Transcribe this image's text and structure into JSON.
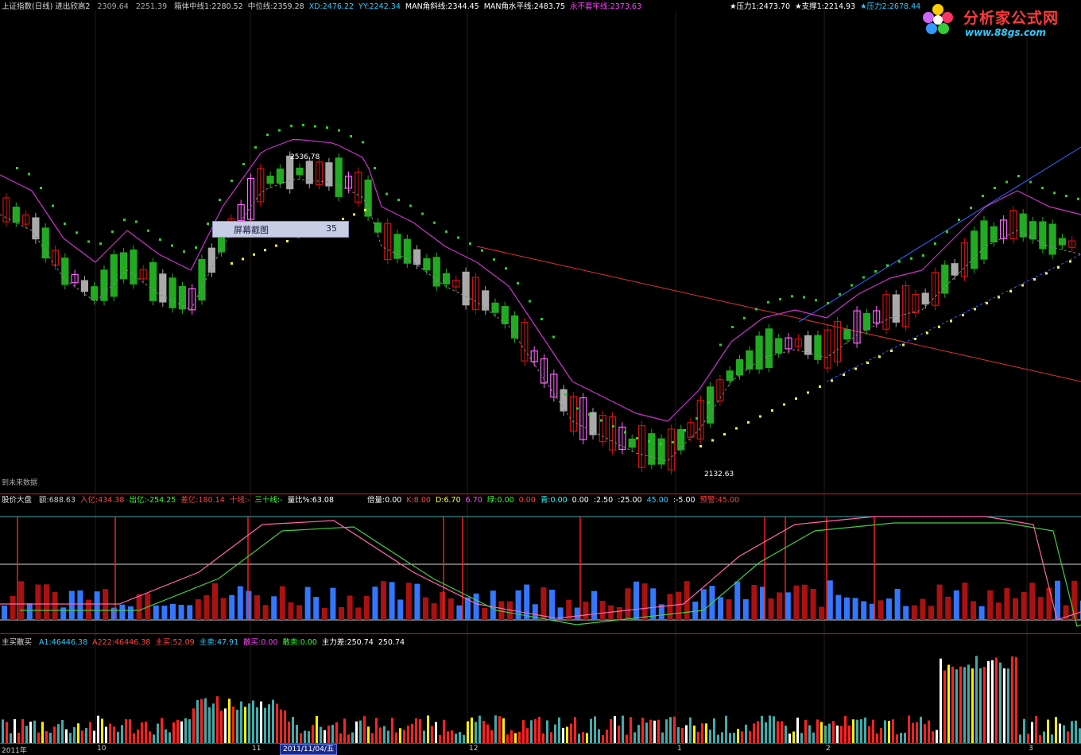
{
  "header": {
    "title": "上证指数(日线) 进出欣高2",
    "v1": "2309.64",
    "v2": "2251.39",
    "items": [
      {
        "label": "箱体中线1:",
        "value": "2280.52",
        "color": "#cccccc"
      },
      {
        "label": "中位线:",
        "value": "2359.28",
        "color": "#cccccc"
      },
      {
        "label": "XD:",
        "value": "2476.22",
        "color": "#33ccff"
      },
      {
        "label": "YY:",
        "value": "2242.34",
        "color": "#33ccff"
      },
      {
        "label": "MAN角斜线:",
        "value": "2344.45",
        "color": "#ffffff"
      },
      {
        "label": "MAN角水平线:",
        "value": "2483.75",
        "color": "#ffffff"
      },
      {
        "label": "永不套牢线:",
        "value": "2373.63",
        "color": "#ff44ff"
      }
    ],
    "right": [
      {
        "label": "★压力1:",
        "value": "2473.70",
        "color": "#ffffff"
      },
      {
        "label": "★支撑1:",
        "value": "2214.93",
        "color": "#ffffff"
      },
      {
        "label": "★压力2:",
        "value": "2678.44",
        "color": "#33ccff"
      }
    ]
  },
  "logo": {
    "title": "分析家公式网",
    "url": "www.88gs.com"
  },
  "tooltip": {
    "label": "屏幕截图",
    "value": "35"
  },
  "price_labels": {
    "high": "2536.78",
    "low": "2132.63"
  },
  "future_note": "到未来数据",
  "panel2": {
    "name": "股价大盘",
    "items": [
      {
        "label": "额:",
        "value": "688.63",
        "color": "#cccccc"
      },
      {
        "label": "入亿:",
        "value": "434.38",
        "color": "#ff4444"
      },
      {
        "label": "出亿:",
        "value": "-254.25",
        "color": "#33ff33"
      },
      {
        "label": "差亿:",
        "value": "180.14",
        "color": "#ff4444"
      },
      {
        "label": "十线:",
        "value": "-",
        "color": "#ff4444"
      },
      {
        "label": "三十线:",
        "value": "-",
        "color": "#33ff33"
      },
      {
        "label": "量比%:",
        "value": "63.08",
        "color": "#ffffff"
      }
    ],
    "right": [
      {
        "label": "倍量:",
        "value": "0.00",
        "color": "#ffffff"
      },
      {
        "label": "K:",
        "value": "8.00",
        "color": "#ff4444"
      },
      {
        "label": "D:",
        "value": "6.70",
        "color": "#ffff44"
      },
      {
        "label": "",
        "value": "6.70",
        "color": "#ff44ff"
      },
      {
        "label": "绿:",
        "value": "0.00",
        "color": "#33ff33"
      },
      {
        "label": "",
        "value": "0.00",
        "color": "#ff4444"
      },
      {
        "label": "青:",
        "value": "0.00",
        "color": "#33ffff"
      },
      {
        "label": "",
        "value": "0.00",
        "color": "#ffffff"
      },
      {
        "label": ":",
        "value": "2.50",
        "color": "#ffffff"
      },
      {
        "label": ":",
        "value": "25.00",
        "color": "#ffffff"
      },
      {
        "label": "",
        "value": "45.00",
        "color": "#33ccff"
      },
      {
        "label": ":",
        "value": "-5.00",
        "color": "#ffffff"
      },
      {
        "label": "预警:",
        "value": "45.00",
        "color": "#ff4444"
      }
    ]
  },
  "panel3": {
    "name": "主买散买",
    "items": [
      {
        "label": "A1:",
        "value": "46446.38",
        "color": "#33ccff"
      },
      {
        "label": "A222:",
        "value": "46446.38",
        "color": "#ff4444"
      },
      {
        "label": "主买:",
        "value": "52.09",
        "color": "#ff4444"
      },
      {
        "label": "主卖:",
        "value": "47.91",
        "color": "#33ccff"
      },
      {
        "label": "散买:",
        "value": "0.00",
        "color": "#ff44ff"
      },
      {
        "label": "散卖:",
        "value": "0.00",
        "color": "#33ff33"
      },
      {
        "label": "主力差:",
        "value": "250.74",
        "color": "#ffffff"
      },
      {
        "label": "",
        "value": "250.74",
        "color": "#ffffff"
      }
    ]
  },
  "x_axis": {
    "labels": [
      "2011年",
      "10",
      "11",
      "12",
      "1",
      "2",
      "3"
    ],
    "selected_date": "2011/11/04/五"
  }
}
